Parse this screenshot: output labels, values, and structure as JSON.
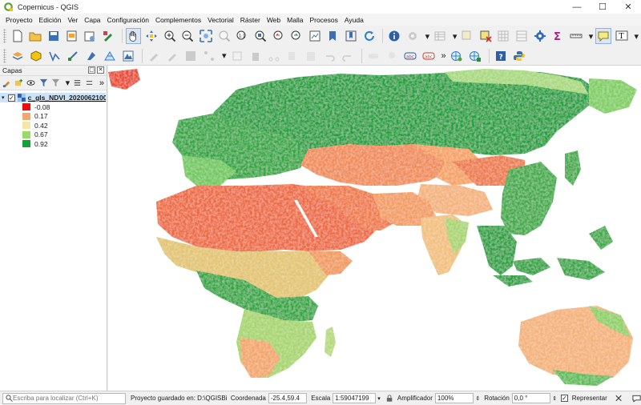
{
  "window": {
    "title": "Copernicus - QGIS",
    "minimize": "—",
    "maximize": "☐",
    "close": "✕"
  },
  "menu": [
    "Proyecto",
    "Edición",
    "Ver",
    "Capa",
    "Configuración",
    "Complementos",
    "Vectorial",
    "Ráster",
    "Web",
    "Malla",
    "Procesos",
    "Ayuda"
  ],
  "toolbar": {
    "overflow": "»"
  },
  "layers_panel": {
    "title": "Capas",
    "float_button": "▢",
    "close_button": "✕",
    "overflow": "»",
    "layer": {
      "name": "c_gls_NDVI_2020062100",
      "checked": "✓",
      "expander": "▾",
      "legend": [
        {
          "label": "-0.08",
          "color": "#f50a0a"
        },
        {
          "label": "0.17",
          "color": "#f7a66b"
        },
        {
          "label": "0.42",
          "color": "#f4e6a4"
        },
        {
          "label": "0.67",
          "color": "#9ad96a"
        },
        {
          "label": "0.92",
          "color": "#13a13a"
        }
      ]
    }
  },
  "map": {
    "background": "#ffffff"
  },
  "statusbar": {
    "locator_placeholder": "Escriba para localizar (Ctrl+K)",
    "message": "Proyecto guardado en: D:\\QGISBiodiversid",
    "coord_label": "Coordenada",
    "coord_value": "-25.4,59.4",
    "scale_label": "Escala",
    "scale_value": "1:59047199",
    "magnifier_label": "Amplificador",
    "magnifier_value": "100%",
    "rotation_label": "Rotación",
    "rotation_value": "0,0 °",
    "render_label": "Representar",
    "render_checked": "✓"
  }
}
